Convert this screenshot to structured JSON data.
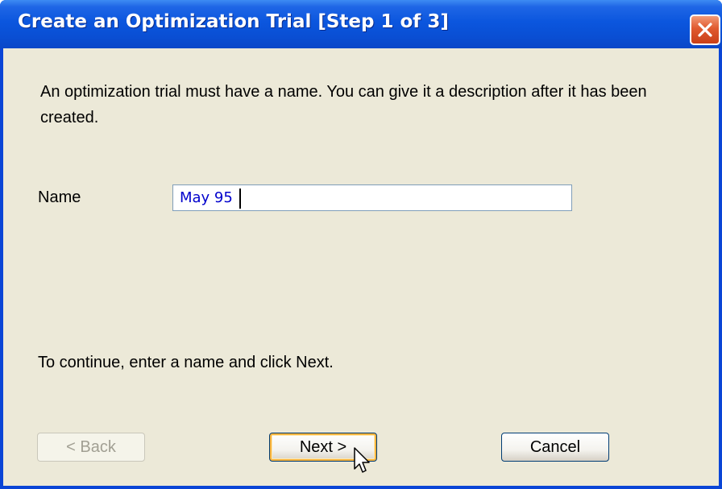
{
  "window": {
    "title": "Create an Optimization Trial [Step 1 of 3]",
    "close_icon": "close-icon",
    "title_color": "#0a4fd4",
    "close_color": "#e05a2f",
    "client_bg": "#ece9d8"
  },
  "content": {
    "intro": "An optimization trial must have a name. You can give it a description after it has been created.",
    "name_label": "Name",
    "name_value": "May 95",
    "hint": "To continue, enter a name and click Next."
  },
  "buttons": {
    "back": "< Back",
    "next": "Next >",
    "cancel": "Cancel"
  },
  "cursor": {
    "icon": "arrow-cursor-icon"
  }
}
